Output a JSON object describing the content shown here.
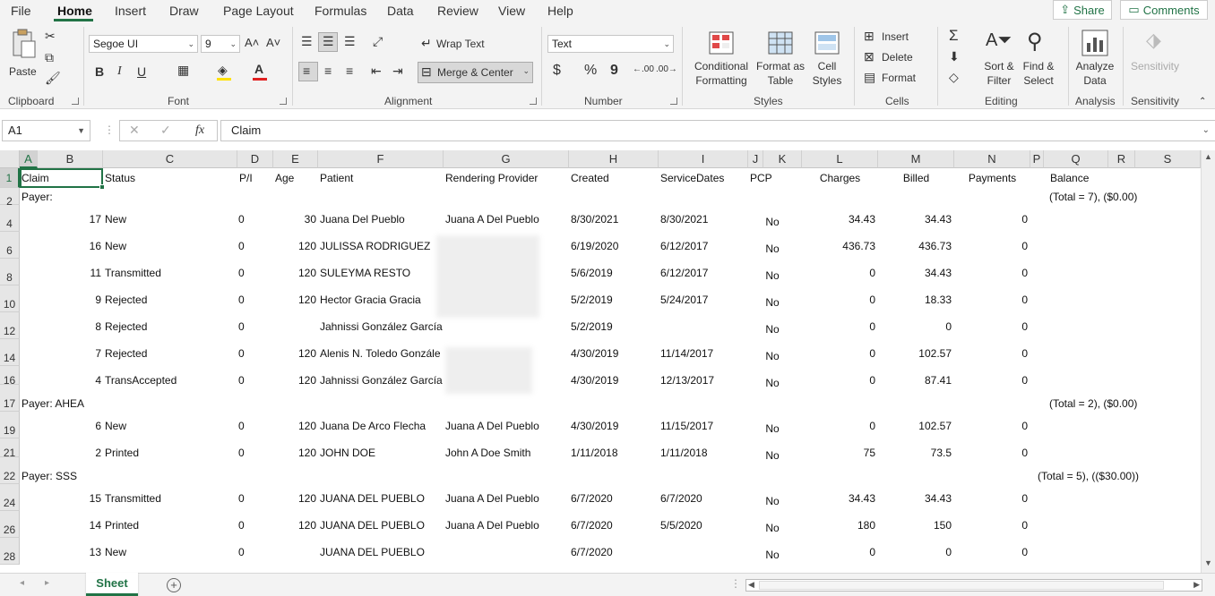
{
  "menu": {
    "tabs": [
      "File",
      "Home",
      "Insert",
      "Draw",
      "Page Layout",
      "Formulas",
      "Data",
      "Review",
      "View",
      "Help"
    ],
    "active": "Home",
    "share": "Share",
    "comments": "Comments"
  },
  "ribbon": {
    "clipboard": {
      "paste": "Paste",
      "label": "Clipboard"
    },
    "font": {
      "name": "Segoe UI",
      "size": "9",
      "bold": "B",
      "italic": "I",
      "underline": "U",
      "label": "Font",
      "font_color": "#e02020",
      "highlight_color": "#ffe100"
    },
    "alignment": {
      "wrap_text": "Wrap Text",
      "merge_center": "Merge & Center",
      "label": "Alignment"
    },
    "number": {
      "format": "Text",
      "currency": "$",
      "percent": "%",
      "comma": "9",
      "label": "Number"
    },
    "styles": {
      "conditional_1": "Conditional",
      "conditional_2": "Formatting",
      "format_table_1": "Format as",
      "format_table_2": "Table",
      "cell_styles_1": "Cell",
      "cell_styles_2": "Styles",
      "label": "Styles"
    },
    "cells": {
      "insert": "Insert",
      "delete": "Delete",
      "format": "Format",
      "label": "Cells"
    },
    "editing": {
      "sort_1": "Sort &",
      "sort_2": "Filter",
      "find_1": "Find &",
      "find_2": "Select",
      "label": "Editing"
    },
    "analysis": {
      "analyze_1": "Analyze",
      "analyze_2": "Data",
      "label": "Analysis"
    },
    "sensitivity": {
      "button": "Sensitivity",
      "label": "Sensitivity"
    }
  },
  "formula_bar": {
    "name_box": "A1",
    "fx": "fx",
    "content": "Claim"
  },
  "accent_color": "#217346",
  "columns": [
    "A",
    "B",
    "C",
    "D",
    "E",
    "F",
    "G",
    "H",
    "I",
    "J",
    "K",
    "L",
    "M",
    "N",
    "P",
    "Q",
    "R",
    "S"
  ],
  "rows": [
    "1",
    "2",
    "4",
    "6",
    "8",
    "10",
    "12",
    "14",
    "16",
    "17",
    "19",
    "21",
    "22",
    "24",
    "26",
    "28"
  ],
  "headers": {
    "claim": "Claim",
    "status": "Status",
    "pi": "P/I",
    "age": "Age",
    "patient": "Patient",
    "provider": "Rendering Provider",
    "created": "Created",
    "service": "ServiceDates",
    "pcp": "PCP",
    "charges": "Charges",
    "billed": "Billed",
    "payments": "Payments",
    "balance": "Balance"
  },
  "groups": [
    {
      "label": "Payer:",
      "total": "(Total = 7), ($0.00)"
    },
    {
      "label": "Payer: AHEA",
      "total": "(Total = 2), ($0.00)"
    },
    {
      "label": "Payer: SSS",
      "total": "(Total = 5), (($30.00))"
    }
  ],
  "records": [
    {
      "claim": "17",
      "status": "New",
      "pi": "0",
      "age": "30",
      "patient": "Juana  Del Pueblo",
      "provider": "Juana A Del Pueblo",
      "created": "8/30/2021",
      "service": "8/30/2021",
      "pcp": "No",
      "charges": "34.43",
      "billed": "34.43",
      "payments": "0"
    },
    {
      "claim": "16",
      "status": "New",
      "pi": "0",
      "age": "120",
      "patient": "JULISSA RODRIGUEZ",
      "provider": "",
      "created": "6/19/2020",
      "service": "6/12/2017",
      "pcp": "No",
      "charges": "436.73",
      "billed": "436.73",
      "payments": "0"
    },
    {
      "claim": "11",
      "status": "Transmitted",
      "pi": "0",
      "age": "120",
      "patient": "SULEYMA RESTO",
      "provider": "",
      "created": "5/6/2019",
      "service": "6/12/2017",
      "pcp": "No",
      "charges": "0",
      "billed": "34.43",
      "payments": "0"
    },
    {
      "claim": "9",
      "status": "Rejected",
      "pi": "0",
      "age": "120",
      "patient": "Hector Gracia Gracia",
      "provider": "",
      "created": "5/2/2019",
      "service": "5/24/2017",
      "pcp": "No",
      "charges": "0",
      "billed": "18.33",
      "payments": "0"
    },
    {
      "claim": "8",
      "status": "Rejected",
      "pi": "0",
      "age": "",
      "patient": "Jahnissi González García",
      "provider": "",
      "created": "5/2/2019",
      "service": "",
      "pcp": "No",
      "charges": "0",
      "billed": "0",
      "payments": "0"
    },
    {
      "claim": "7",
      "status": "Rejected",
      "pi": "0",
      "age": "120",
      "patient": "Alenis  N. Toledo  Gonzále",
      "provider": "",
      "created": "4/30/2019",
      "service": "11/14/2017",
      "pcp": "No",
      "charges": "0",
      "billed": "102.57",
      "payments": "0"
    },
    {
      "claim": "4",
      "status": "TransAccepted",
      "pi": "0",
      "age": "120",
      "patient": "Jahnissi González García",
      "provider": "",
      "created": "4/30/2019",
      "service": "12/13/2017",
      "pcp": "No",
      "charges": "0",
      "billed": "87.41",
      "payments": "0"
    },
    {
      "claim": "6",
      "status": "New",
      "pi": "0",
      "age": "120",
      "patient": "Juana  De Arco Flecha",
      "provider": "Juana A Del Pueblo",
      "created": "4/30/2019",
      "service": "11/15/2017",
      "pcp": "No",
      "charges": "0",
      "billed": "102.57",
      "payments": "0"
    },
    {
      "claim": "2",
      "status": "Printed",
      "pi": "0",
      "age": "120",
      "patient": "JOHN DOE",
      "provider": "John A Doe Smith",
      "created": "1/11/2018",
      "service": "1/11/2018",
      "pcp": "No",
      "charges": "75",
      "billed": "73.5",
      "payments": "0"
    },
    {
      "claim": "15",
      "status": "Transmitted",
      "pi": "0",
      "age": "120",
      "patient": "JUANA DEL PUEBLO",
      "provider": "Juana A Del Pueblo",
      "created": "6/7/2020",
      "service": "6/7/2020",
      "pcp": "No",
      "charges": "34.43",
      "billed": "34.43",
      "payments": "0"
    },
    {
      "claim": "14",
      "status": "Printed",
      "pi": "0",
      "age": "120",
      "patient": "JUANA DEL PUEBLO",
      "provider": "Juana A Del Pueblo",
      "created": "6/7/2020",
      "service": "5/5/2020",
      "pcp": "No",
      "charges": "180",
      "billed": "150",
      "payments": "0"
    },
    {
      "claim": "13",
      "status": "New",
      "pi": "0",
      "age": "",
      "patient": "JUANA DEL PUEBLO",
      "provider": "",
      "created": "6/7/2020",
      "service": "",
      "pcp": "No",
      "charges": "0",
      "billed": "0",
      "payments": "0"
    }
  ],
  "sheet_tab": "Sheet"
}
